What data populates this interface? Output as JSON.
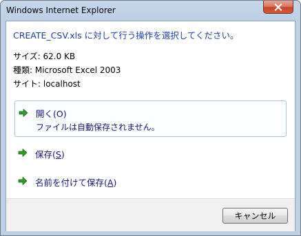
{
  "window": {
    "title": "Windows Internet Explorer"
  },
  "dialog": {
    "instruction": "CREATE_CSV.xls に対して行う操作を選択してください。",
    "size_line": "サイズ: 62.0 KB",
    "type_line": "種類: Microsoft Excel 2003",
    "site_line": "サイト: localhost",
    "open": {
      "label": "開く(O)",
      "description": "ファイルは自動保存されません。"
    },
    "save": {
      "label_prefix": "保存(",
      "label_key": "S",
      "label_suffix": ")"
    },
    "save_as": {
      "label_prefix": "名前を付けて保存(",
      "label_key": "A",
      "label_suffix": ")"
    },
    "cancel_label": "キャンセル"
  },
  "icons": {
    "close": "close-icon",
    "command_arrow": "green-arrow-icon"
  },
  "colors": {
    "instruction_text": "#1e3dab",
    "command_text": "#15157a",
    "arrow_green": "#2e9a2a",
    "close_red": "#c7452a"
  }
}
